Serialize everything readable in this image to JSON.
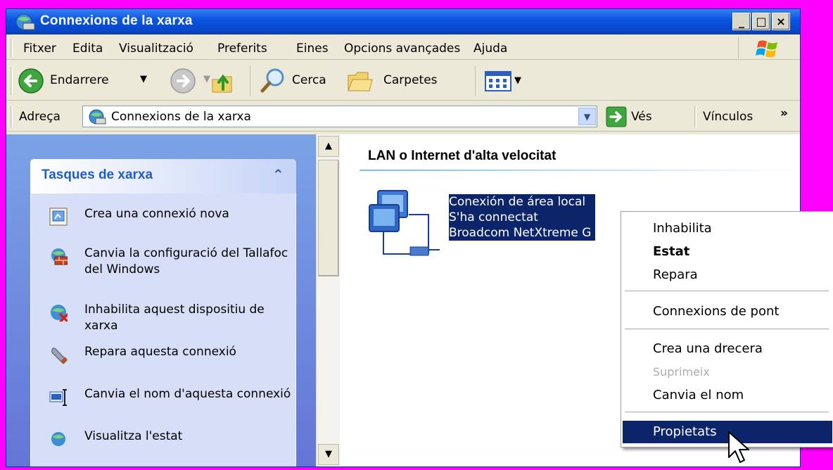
{
  "window": {
    "title": "Connexions de la xarxa",
    "minimize_glyph": "_",
    "maximize_glyph": "□",
    "close_glyph": "×"
  },
  "menu": {
    "items": [
      "Fitxer",
      "Edita",
      "Visualització",
      "Preferits",
      "Eines",
      "Opcions avançades",
      "Ajuda"
    ]
  },
  "toolbar": {
    "back_label": "Endarrere",
    "search_label": "Cerca",
    "folders_label": "Carpetes"
  },
  "address": {
    "label": "Adreça",
    "value": "Connexions de la xarxa",
    "go_label": "Vés",
    "links_label": "Vínculos",
    "links_chevron": "»"
  },
  "tasks": {
    "title": "Tasques de xarxa",
    "collapse_glyph": "⌃",
    "items": [
      {
        "label": "Crea una connexió nova",
        "icon": "new-connection-icon"
      },
      {
        "label": "Canvia la configuració del Tallafoc del Windows",
        "icon": "firewall-icon"
      },
      {
        "label": "Inhabilita aquest dispositiu de xarxa",
        "icon": "disable-network-icon"
      },
      {
        "label": "Repara aquesta connexió",
        "icon": "wrench-icon"
      },
      {
        "label": "Canvia el nom d'aquesta connexió",
        "icon": "rename-icon"
      },
      {
        "label": "Visualitza l'estat",
        "icon": "status-icon"
      }
    ]
  },
  "content": {
    "group_header": "LAN o Internet d'alta velocitat",
    "connection": {
      "name": "Conexión de área local",
      "status": "S'ha connectat",
      "device": "Broadcom NetXtreme G"
    }
  },
  "context_menu": {
    "items": [
      {
        "label": "Inhabilita"
      },
      {
        "label": "Estat",
        "bold": true
      },
      {
        "label": "Repara"
      },
      {
        "label": "Connexions de pont"
      },
      {
        "label": "Crea una drecera"
      },
      {
        "label": "Suprimeix",
        "disabled": true
      },
      {
        "label": "Canvia el nom"
      },
      {
        "label": "Propietats",
        "selected": true
      }
    ]
  },
  "colors": {
    "title_blue": "#0a55e3",
    "selection": "#0c246a",
    "task_title": "#215dc6",
    "disabled_text": "#acaca8"
  }
}
